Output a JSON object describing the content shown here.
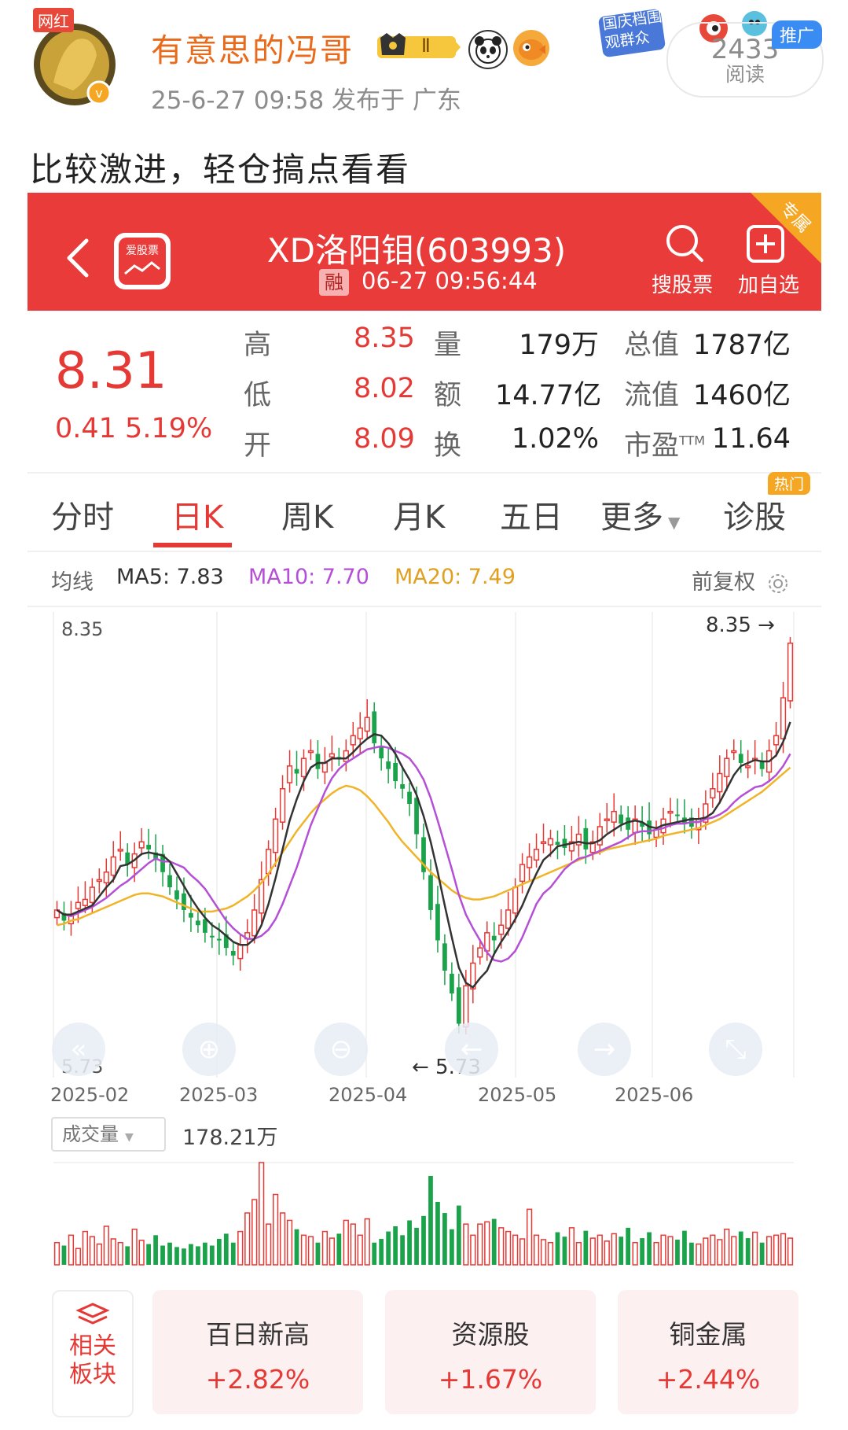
{
  "post": {
    "username": "有意思的冯哥",
    "avatar_tag": "网红",
    "level": "Ⅱ",
    "meta": "25-6-27 09:58  发布于 广东",
    "read_count": "2433",
    "read_label": "阅读",
    "promo_tag": "推广",
    "campaign_badge": "国庆档围观群众",
    "text": "比较激进，轻仓搞点看看"
  },
  "app": {
    "back_icon": "back-arrow",
    "logo_text": "爱股票",
    "title": "XD洛阳钼(603993)",
    "rong": "融",
    "time": "06-27 09:56:44",
    "search_label": "搜股票",
    "add_label": "加自选",
    "corner_tag": "专属",
    "brand_color": "#ea3b3b"
  },
  "quote": {
    "price": "8.31",
    "change": "0.41  5.19%",
    "rows": [
      {
        "l1": "高",
        "v1": "8.35",
        "l2": "量",
        "v2": "179万",
        "l3": "总值",
        "v3": "1787亿"
      },
      {
        "l1": "低",
        "v1": "8.02",
        "l2": "额",
        "v2": "14.77亿",
        "l3": "流值",
        "v3": "1460亿"
      },
      {
        "l1": "开",
        "v1": "8.09",
        "l2": "换",
        "v2": "1.02%",
        "l3": "市盈",
        "l3sup": "TTM",
        "v3": "11.64"
      }
    ]
  },
  "tabs": {
    "items": [
      "分时",
      "日K",
      "周K",
      "月K",
      "五日",
      "更多",
      "诊股"
    ],
    "active": "日K",
    "hot_tag": "热门"
  },
  "ma": {
    "label": "均线",
    "ma5": "MA5: 7.83",
    "ma10": "MA10: 7.70",
    "ma20": "MA20: 7.49",
    "adjust": "前复权",
    "colors": {
      "ma5": "#333333",
      "ma10": "#b44fd6",
      "ma20": "#f0b429"
    }
  },
  "chart_data": {
    "type": "candlestick",
    "high_label": "8.35",
    "high_marker": "8.35 →",
    "low_label": "5.73",
    "low_marker": "← 5.73",
    "x_labels": [
      "2025-02",
      "2025-03",
      "2025-04",
      "2025-05",
      "2025-06"
    ],
    "ylim": [
      5.73,
      8.35
    ],
    "close": [
      6.55,
      6.48,
      6.52,
      6.6,
      6.62,
      6.7,
      6.75,
      6.8,
      6.9,
      6.95,
      6.85,
      6.92,
      7.0,
      6.95,
      6.88,
      6.8,
      6.7,
      6.62,
      6.55,
      6.5,
      6.45,
      6.4,
      6.38,
      6.35,
      6.3,
      6.25,
      6.32,
      6.4,
      6.55,
      6.75,
      6.95,
      7.15,
      7.35,
      7.5,
      7.45,
      7.55,
      7.6,
      7.48,
      7.52,
      7.58,
      7.55,
      7.6,
      7.7,
      7.75,
      7.82,
      7.65,
      7.55,
      7.48,
      7.4,
      7.35,
      7.25,
      7.05,
      6.8,
      6.55,
      6.35,
      6.15,
      6.0,
      5.8,
      6.05,
      6.2,
      6.3,
      6.4,
      6.35,
      6.45,
      6.55,
      6.7,
      6.85,
      6.9,
      6.95,
      7.0,
      7.02,
      6.98,
      6.96,
      7.0,
      7.05,
      6.95,
      7.0,
      7.1,
      7.15,
      7.2,
      7.12,
      7.08,
      7.15,
      7.1,
      7.05,
      7.08,
      7.15,
      7.2,
      7.18,
      7.12,
      7.1,
      7.15,
      7.25,
      7.35,
      7.45,
      7.55,
      7.6,
      7.52,
      7.5,
      7.55,
      7.48,
      7.6,
      7.7,
      7.95,
      8.31
    ],
    "ma5": [
      6.55,
      6.52,
      6.52,
      6.54,
      6.56,
      6.58,
      6.64,
      6.7,
      6.75,
      6.84,
      6.85,
      6.88,
      6.92,
      6.93,
      6.92,
      6.91,
      6.87,
      6.79,
      6.71,
      6.63,
      6.56,
      6.5,
      6.45,
      6.42,
      6.38,
      6.34,
      6.32,
      6.32,
      6.36,
      6.45,
      6.59,
      6.76,
      6.95,
      7.14,
      7.28,
      7.4,
      7.49,
      7.52,
      7.52,
      7.55,
      7.55,
      7.55,
      7.59,
      7.64,
      7.68,
      7.71,
      7.7,
      7.65,
      7.58,
      7.49,
      7.41,
      7.31,
      7.17,
      7.0,
      6.8,
      6.58,
      6.37,
      6.17,
      6.07,
      6.04,
      6.1,
      6.15,
      6.26,
      6.34,
      6.41,
      6.49,
      6.58,
      6.69,
      6.79,
      6.88,
      6.92,
      6.97,
      6.98,
      6.99,
      7.0,
      6.99,
      6.99,
      7.01,
      7.05,
      7.08,
      7.11,
      7.13,
      7.14,
      7.13,
      7.1,
      7.09,
      7.11,
      7.12,
      7.13,
      7.14,
      7.15,
      7.15,
      7.16,
      7.19,
      7.26,
      7.35,
      7.44,
      7.5,
      7.52,
      7.54,
      7.53,
      7.53,
      7.57,
      7.66,
      7.79
    ],
    "ma10": [
      6.55,
      6.52,
      6.51,
      6.53,
      6.55,
      6.57,
      6.6,
      6.63,
      6.67,
      6.71,
      6.74,
      6.78,
      6.82,
      6.86,
      6.89,
      6.87,
      6.87,
      6.85,
      6.83,
      6.78,
      6.74,
      6.69,
      6.62,
      6.55,
      6.48,
      6.43,
      6.39,
      6.36,
      6.36,
      6.38,
      6.42,
      6.49,
      6.59,
      6.71,
      6.83,
      6.97,
      7.11,
      7.22,
      7.33,
      7.42,
      7.48,
      7.52,
      7.55,
      7.58,
      7.61,
      7.62,
      7.63,
      7.62,
      7.6,
      7.58,
      7.55,
      7.49,
      7.41,
      7.29,
      7.14,
      6.98,
      6.82,
      6.65,
      6.52,
      6.43,
      6.35,
      6.27,
      6.22,
      6.21,
      6.23,
      6.28,
      6.37,
      6.48,
      6.59,
      6.66,
      6.7,
      6.76,
      6.82,
      6.86,
      6.89,
      6.9,
      6.92,
      6.94,
      6.96,
      6.98,
      7.0,
      7.03,
      7.06,
      7.07,
      7.07,
      7.08,
      7.09,
      7.11,
      7.12,
      7.12,
      7.13,
      7.13,
      7.15,
      7.16,
      7.18,
      7.21,
      7.26,
      7.3,
      7.33,
      7.36,
      7.37,
      7.4,
      7.44,
      7.5,
      7.58
    ],
    "ma20": [
      6.45,
      6.46,
      6.48,
      6.49,
      6.51,
      6.53,
      6.55,
      6.57,
      6.59,
      6.61,
      6.63,
      6.65,
      6.66,
      6.66,
      6.65,
      6.64,
      6.62,
      6.6,
      6.58,
      6.56,
      6.54,
      6.54,
      6.54,
      6.55,
      6.56,
      6.58,
      6.61,
      6.64,
      6.68,
      6.73,
      6.79,
      6.86,
      6.93,
      7.0,
      7.07,
      7.13,
      7.19,
      7.24,
      7.28,
      7.32,
      7.35,
      7.37,
      7.36,
      7.34,
      7.3,
      7.25,
      7.19,
      7.13,
      7.06,
      7.0,
      6.95,
      6.9,
      6.85,
      6.8,
      6.76,
      6.72,
      6.68,
      6.65,
      6.63,
      6.62,
      6.62,
      6.63,
      6.64,
      6.66,
      6.68,
      6.7,
      6.72,
      6.74,
      6.76,
      6.78,
      6.8,
      6.82,
      6.84,
      6.86,
      6.88,
      6.9,
      6.92,
      6.93,
      6.95,
      6.96,
      6.97,
      6.98,
      6.99,
      7.0,
      7.01,
      7.02,
      7.04,
      7.05,
      7.06,
      7.07,
      7.08,
      7.09,
      7.11,
      7.13,
      7.15,
      7.18,
      7.21,
      7.24,
      7.27,
      7.3,
      7.33,
      7.37,
      7.41,
      7.45,
      7.49
    ]
  },
  "volume": {
    "selector": "成交量",
    "value": "178.21万",
    "bars": [
      30,
      26,
      40,
      22,
      45,
      38,
      28,
      52,
      35,
      30,
      25,
      48,
      33,
      28,
      40,
      26,
      30,
      24,
      22,
      28,
      25,
      30,
      26,
      35,
      42,
      30,
      45,
      70,
      88,
      138,
      55,
      95,
      70,
      60,
      48,
      40,
      38,
      30,
      45,
      36,
      42,
      60,
      55,
      40,
      62,
      30,
      35,
      45,
      52,
      40,
      60,
      50,
      66,
      120,
      85,
      70,
      48,
      80,
      55,
      40,
      55,
      58,
      62,
      50,
      45,
      40,
      35,
      75,
      40,
      34,
      30,
      44,
      38,
      50,
      30,
      46,
      36,
      40,
      32,
      42,
      38,
      50,
      30,
      36,
      44,
      30,
      40,
      38,
      34,
      46,
      30,
      28,
      36,
      40,
      34,
      48,
      38,
      45,
      36,
      44,
      30,
      38,
      40,
      42,
      36
    ],
    "up_color": "#e53935",
    "down_color": "#1aa34a"
  },
  "controls": [
    "rewind-icon",
    "zoom-in-icon",
    "zoom-out-icon",
    "prev-icon",
    "next-icon",
    "expand-icon"
  ],
  "sectors": {
    "related_label": [
      "相关",
      "板块"
    ],
    "items": [
      {
        "name": "百日新高",
        "change": "+2.82%"
      },
      {
        "name": "资源股",
        "change": "+1.67%"
      },
      {
        "name": "铜金属",
        "change": "+2.44%"
      }
    ]
  }
}
